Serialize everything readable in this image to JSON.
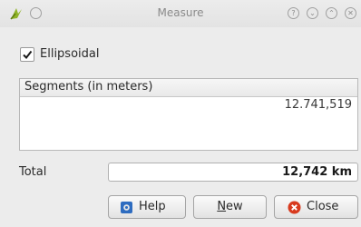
{
  "window": {
    "title": "Measure",
    "buttons": [
      "help",
      "shade",
      "maximize",
      "close"
    ]
  },
  "ellipsoidal": {
    "label": "Ellipsoidal",
    "checked": true
  },
  "segments": {
    "header": "Segments (in meters)",
    "values": [
      "12.741,519"
    ]
  },
  "total": {
    "label": "Total",
    "value": "12,742 km"
  },
  "buttons": {
    "help": {
      "label": "Help",
      "icon": "help-icon"
    },
    "new": {
      "label_mnemonic": "N",
      "label_rest": "ew"
    },
    "close": {
      "label": "Close",
      "icon": "close-icon"
    }
  },
  "colors": {
    "close_icon": "#d83a1e",
    "help_icon": "#2e6cc0",
    "window_bg": "#ececec"
  }
}
